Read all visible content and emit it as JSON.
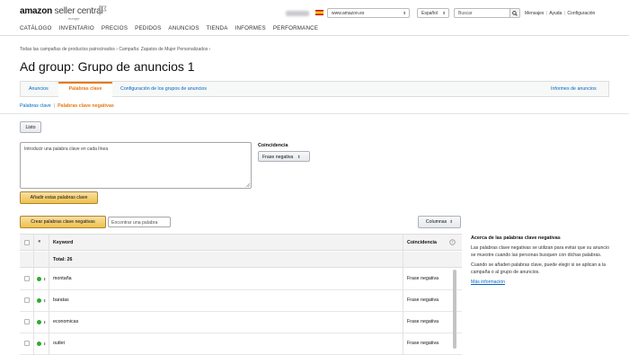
{
  "header": {
    "logo_bold": "amazon",
    "logo_light": " seller central",
    "logo_sub": "europe",
    "nav": [
      "CATÁLOGO",
      "INVENTARIO",
      "PRECIOS",
      "PEDIDOS",
      "ANUNCIOS",
      "TIENDA",
      "INFORMES",
      "PERFORMANCE"
    ],
    "marketplace": "www.amazon.es",
    "language": "Español",
    "search_placeholder": "Buscar",
    "links": [
      "Mensajes",
      "Ayuda",
      "Configuración"
    ]
  },
  "breadcrumb": "Todas las campañas de productos patrocinados  ›  Campaña: Zapatos de Mujer Personalizados  ›",
  "page_title": "Ad group: Grupo de anuncios 1",
  "tabs": [
    {
      "label": "Anuncios"
    },
    {
      "label": "Palabras clave"
    },
    {
      "label": "Configuración de los grupos de anuncios"
    },
    {
      "label": "Informes de anuncios"
    }
  ],
  "subtabs": {
    "first": "Palabras clave",
    "second": "Palabras clave negativas"
  },
  "buttons": {
    "done": "Listo",
    "add_keywords": "Añadir estas palabras clave",
    "create_negative": "Crear palabras clave negativas",
    "columns": "Columnas"
  },
  "form": {
    "textarea_placeholder": "Introducir una palabra clave en cada línea",
    "match_label": "Coincidencia",
    "match_value": "Frase negativa",
    "find_placeholder": "Encontrar una palabra"
  },
  "table": {
    "col_keyword": "Keyword",
    "col_match": "Coincidencia",
    "total": "Total: 26",
    "rows": [
      {
        "keyword": "montaña",
        "match": "Frase negativa"
      },
      {
        "keyword": "baratas",
        "match": "Frase negativa"
      },
      {
        "keyword": "economicas",
        "match": "Frase negativa"
      },
      {
        "keyword": "outlet",
        "match": "Frase negativa"
      }
    ]
  },
  "help": {
    "title": "Acerca de las palabras clave negativas",
    "p1": "Las palabras clave negativas se utilizan para evitar que su anuncio se muestre cuando las personas busquen con dichas palabras.",
    "p2": "Cuando se añaden palabras clave, puede elegir si se aplican a la campaña o al grupo de anuncios.",
    "link": "Más información"
  },
  "colors": {
    "accent": "#e47911",
    "link": "#0066c0",
    "primary_button": "#f0c14b",
    "status_active": "#2dab2d"
  }
}
